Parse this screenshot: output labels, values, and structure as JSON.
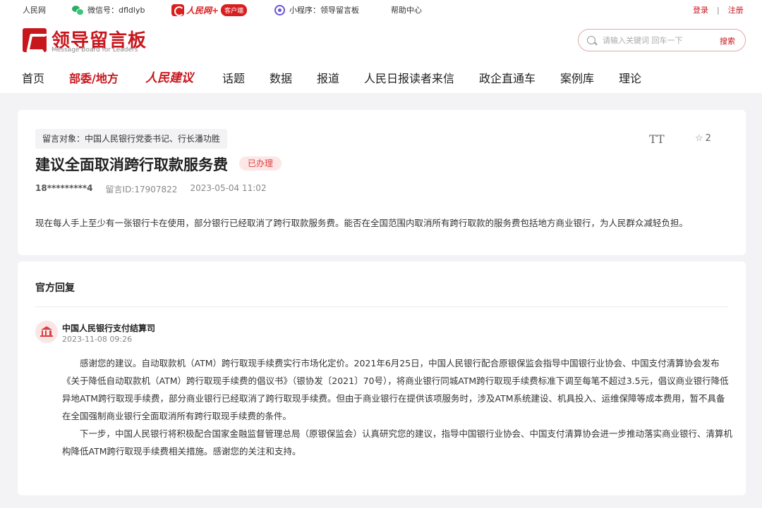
{
  "topbar": {
    "site_link": "人民网",
    "wechat_label": "微信号：dfldlyb",
    "rmw_brand": "人民网+",
    "rmw_tag": "客户端",
    "miniprogram_label": "小程序：领导留言板",
    "help": "帮助中心",
    "login": "登录",
    "separator": "|",
    "register": "注册"
  },
  "header": {
    "brand_name": "领导留言板",
    "brand_sub": "Message Board for Leaders",
    "search_placeholder": "请输入关键词 回车一下",
    "search_button": "搜索"
  },
  "nav": {
    "items": [
      "首页",
      "部委/地方",
      "人民建议",
      "话题",
      "数据",
      "报道",
      "人民日报读者来信",
      "政企直通车",
      "案例库",
      "理论"
    ],
    "active_index": 1
  },
  "message": {
    "target": "留言对象：中国人民银行党委书记、行长潘功胜",
    "font_toggle": "TT",
    "favorites": "2",
    "title": "建议全面取消跨行取款服务费",
    "status": "已办理",
    "author": "18*********4",
    "message_id": "留言ID:17907822",
    "datetime": "2023-05-04 11:02",
    "content": "现在每人手上至少有一张银行卡在使用，部分银行已经取消了跨行取款服务费。能否在全国范围内取消所有跨行取款的服务费包括地方商业银行，为人民群众减轻负担。"
  },
  "reply": {
    "heading": "官方回复",
    "org_name": "中国人民银行支付结算司",
    "org_date": "2023-11-08 09:26",
    "paragraphs": [
      "感谢您的建议。自动取款机（ATM）跨行取现手续费实行市场化定价。2021年6月25日，中国人民银行配合原银保监会指导中国银行业协会、中国支付清算协会发布《关于降低自动取款机（ATM）跨行取现手续费的倡议书》（银协发〔2021〕70号），将商业银行同城ATM跨行取现手续费标准下调至每笔不超过3.5元，倡议商业银行降低异地ATM跨行取现手续费，部分商业银行已经取消了跨行取现手续费。但由于商业银行在提供该项服务时，涉及ATM系统建设、机具投入、运维保障等成本费用，暂不具备在全国强制商业银行全面取消所有跨行取现手续费的条件。",
      "下一步，中国人民银行将积极配合国家金融监督管理总局（原银保监会）认真研究您的建议，指导中国银行业协会、中国支付清算协会进一步推动落实商业银行、清算机构降低ATM跨行取现手续费相关措施。感谢您的关注和支持。"
    ]
  },
  "colors": {
    "brand_red": "#c8161d",
    "status_bg": "#fde6e6",
    "status_text": "#d94040",
    "page_bg": "#f3f3f5"
  }
}
